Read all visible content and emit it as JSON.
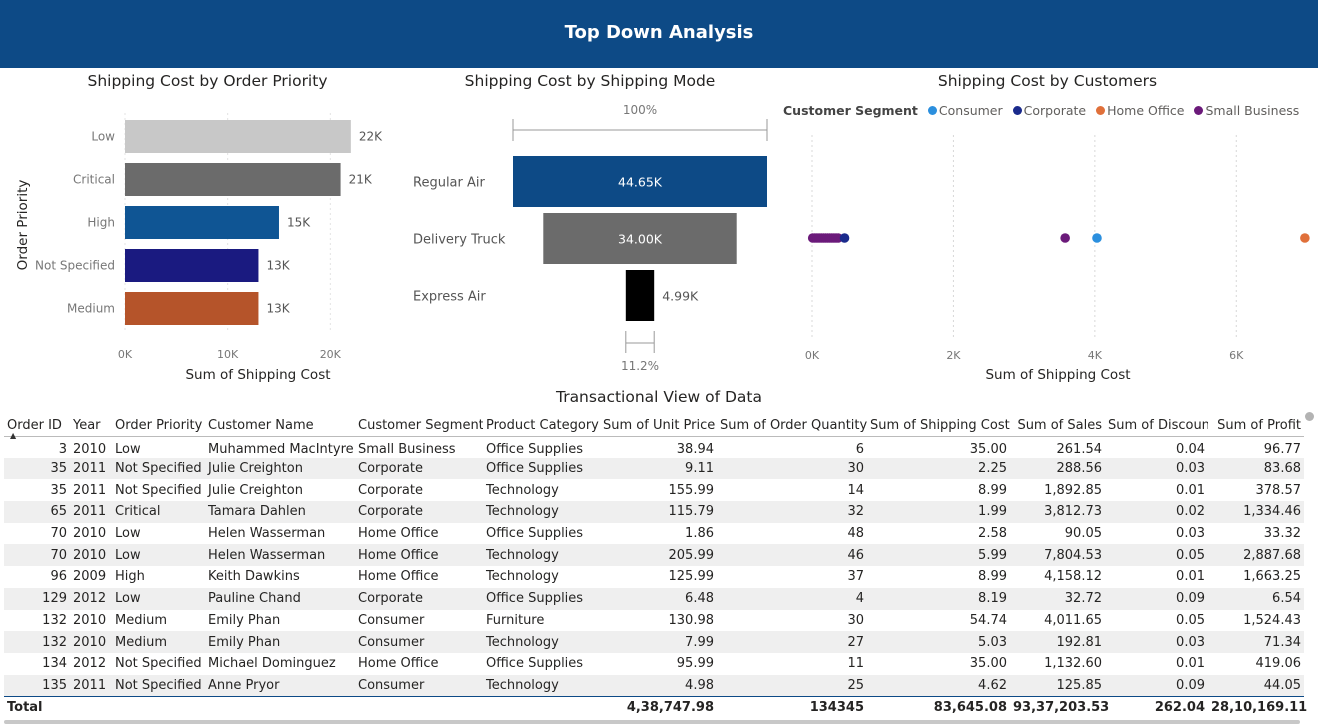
{
  "header": {
    "title": "Top Down Analysis"
  },
  "colors": {
    "header_bg": "#0d4a86"
  },
  "charts": {
    "priority": {
      "title": "Shipping Cost by Order Priority",
      "xlabel": "Sum of Shipping Cost",
      "ylabel": "Order Priority",
      "x_ticks": [
        "0K",
        "10K",
        "20K"
      ],
      "x_tick_values": [
        0,
        10000,
        20000
      ],
      "categories": [
        "Low",
        "Critical",
        "High",
        "Not Specified",
        "Medium"
      ],
      "values": [
        22000,
        21000,
        15000,
        13000,
        13000
      ],
      "labels": [
        "22K",
        "21K",
        "15K",
        "13K",
        "13K"
      ],
      "colors": [
        "#c8c8c8",
        "#6b6b6b",
        "#0f5594",
        "#1a1a80",
        "#b5542a"
      ],
      "xmax": 22600
    },
    "mode": {
      "title": "Shipping Cost by Shipping Mode",
      "top_pct": "100%",
      "bottom_pct": "11.2%",
      "categories": [
        "Regular Air",
        "Delivery Truck",
        "Express Air"
      ],
      "values": [
        44650,
        34000,
        4990
      ],
      "labels": [
        "44.65K",
        "34.00K",
        "4.99K"
      ],
      "colors": [
        "#0d4a86",
        "#6b6b6b",
        "#000000"
      ]
    },
    "customers": {
      "title": "Shipping Cost by Customers",
      "xlabel": "Sum of Shipping Cost",
      "legend_title": "Customer Segment",
      "legend": [
        {
          "name": "Consumer",
          "color": "#2b8fde"
        },
        {
          "name": "Corporate",
          "color": "#1a2a8c"
        },
        {
          "name": "Home Office",
          "color": "#e0703a"
        },
        {
          "name": "Small Business",
          "color": "#6b1a7a"
        }
      ],
      "x_ticks": [
        "0K",
        "2K",
        "4K",
        "6K"
      ],
      "x_tick_values": [
        0,
        2000,
        4000,
        6000
      ]
    }
  },
  "chart_data": [
    {
      "type": "bar",
      "title": "Shipping Cost by Order Priority",
      "categories": [
        "Low",
        "Critical",
        "High",
        "Not Specified",
        "Medium"
      ],
      "values": [
        22000,
        21000,
        15000,
        13000,
        13000
      ],
      "xlabel": "Sum of Shipping Cost",
      "ylabel": "Order Priority"
    },
    {
      "type": "bar",
      "title": "Shipping Cost by Shipping Mode",
      "categories": [
        "Regular Air",
        "Delivery Truck",
        "Express Air"
      ],
      "values": [
        44650,
        34000,
        4990
      ]
    },
    {
      "type": "scatter",
      "title": "Shipping Cost by Customers",
      "xlabel": "Sum of Shipping Cost",
      "xlim": [
        0,
        7000
      ],
      "series": [
        {
          "name": "Small Business",
          "x": [
            10,
            40,
            70,
            100,
            130,
            160,
            190,
            220,
            250,
            280,
            310,
            340,
            370,
            3580
          ]
        },
        {
          "name": "Corporate",
          "x": [
            460
          ]
        },
        {
          "name": "Consumer",
          "x": [
            4030
          ]
        },
        {
          "name": "Home Office",
          "x": [
            6970
          ]
        }
      ]
    }
  ],
  "table": {
    "title": "Transactional View of Data",
    "columns": [
      "Order ID",
      "Year",
      "Order Priority",
      "Customer Name",
      "Customer Segment",
      "Product Category",
      "Sum of Unit Price",
      "Sum of Order Quantity",
      "Sum of Shipping Cost",
      "Sum of Sales",
      "Sum of Discount",
      "Sum of Profit"
    ],
    "rows": [
      [
        "3",
        "2010",
        "Low",
        "Muhammed MacIntyre",
        "Small Business",
        "Office Supplies",
        "38.94",
        "6",
        "35.00",
        "261.54",
        "0.04",
        "96.77"
      ],
      [
        "35",
        "2011",
        "Not Specified",
        "Julie Creighton",
        "Corporate",
        "Office Supplies",
        "9.11",
        "30",
        "2.25",
        "288.56",
        "0.03",
        "83.68"
      ],
      [
        "35",
        "2011",
        "Not Specified",
        "Julie Creighton",
        "Corporate",
        "Technology",
        "155.99",
        "14",
        "8.99",
        "1,892.85",
        "0.01",
        "378.57"
      ],
      [
        "65",
        "2011",
        "Critical",
        "Tamara Dahlen",
        "Corporate",
        "Technology",
        "115.79",
        "32",
        "1.99",
        "3,812.73",
        "0.02",
        "1,334.46"
      ],
      [
        "70",
        "2010",
        "Low",
        "Helen Wasserman",
        "Home Office",
        "Office Supplies",
        "1.86",
        "48",
        "2.58",
        "90.05",
        "0.03",
        "33.32"
      ],
      [
        "70",
        "2010",
        "Low",
        "Helen Wasserman",
        "Home Office",
        "Technology",
        "205.99",
        "46",
        "5.99",
        "7,804.53",
        "0.05",
        "2,887.68"
      ],
      [
        "96",
        "2009",
        "High",
        "Keith Dawkins",
        "Home Office",
        "Technology",
        "125.99",
        "37",
        "8.99",
        "4,158.12",
        "0.01",
        "1,663.25"
      ],
      [
        "129",
        "2012",
        "Low",
        "Pauline Chand",
        "Corporate",
        "Office Supplies",
        "6.48",
        "4",
        "8.19",
        "32.72",
        "0.09",
        "6.54"
      ],
      [
        "132",
        "2010",
        "Medium",
        "Emily Phan",
        "Consumer",
        "Furniture",
        "130.98",
        "30",
        "54.74",
        "4,011.65",
        "0.05",
        "1,524.43"
      ],
      [
        "132",
        "2010",
        "Medium",
        "Emily Phan",
        "Consumer",
        "Technology",
        "7.99",
        "27",
        "5.03",
        "192.81",
        "0.03",
        "71.34"
      ],
      [
        "134",
        "2012",
        "Not Specified",
        "Michael Dominguez",
        "Home Office",
        "Office Supplies",
        "95.99",
        "11",
        "35.00",
        "1,132.60",
        "0.01",
        "419.06"
      ],
      [
        "135",
        "2011",
        "Not Specified",
        "Anne Pryor",
        "Consumer",
        "Technology",
        "4.98",
        "25",
        "4.62",
        "125.85",
        "0.09",
        "44.05"
      ]
    ],
    "total": [
      "Total",
      "",
      "",
      "",
      "",
      "",
      "4,38,747.98",
      "134345",
      "83,645.08",
      "93,37,203.53",
      "262.04",
      "28,10,169.11"
    ]
  }
}
